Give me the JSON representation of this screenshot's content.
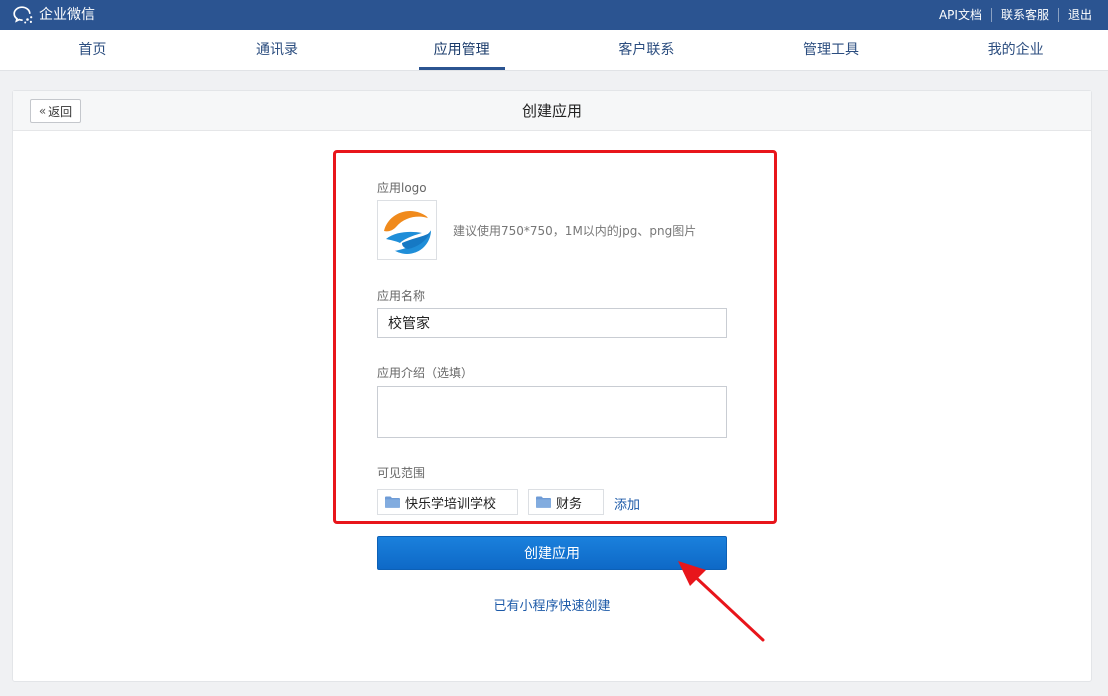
{
  "brand": {
    "name": "企业微信",
    "icon": "wecom-chat-icon"
  },
  "top_links": [
    {
      "label": "API文档"
    },
    {
      "label": "联系客服"
    },
    {
      "label": "退出"
    }
  ],
  "nav": {
    "active_index": 2,
    "items": [
      {
        "label": "首页"
      },
      {
        "label": "通讯录"
      },
      {
        "label": "应用管理"
      },
      {
        "label": "客户联系"
      },
      {
        "label": "管理工具"
      },
      {
        "label": "我的企业"
      }
    ]
  },
  "page": {
    "title": "创建应用",
    "back_label": "返回"
  },
  "form": {
    "logo_label": "应用logo",
    "logo_hint": "建议使用750*750，1M以内的jpg、png图片",
    "name_label": "应用名称",
    "name_value": "校管家",
    "intro_label": "应用介绍（选填）",
    "intro_value": "",
    "scope_label": "可见范围",
    "scope_items": [
      {
        "label": "快乐学培训学校",
        "icon": "folder-icon"
      },
      {
        "label": "财务",
        "icon": "folder-icon"
      }
    ],
    "add_label": "添加",
    "submit_label": "创建应用",
    "mini_program_link": "已有小程序快速创建"
  },
  "colors": {
    "topbar": "#2b5491",
    "accent": "#0f6ecf",
    "highlight": "#e8151b",
    "link": "#1d5aa8"
  }
}
